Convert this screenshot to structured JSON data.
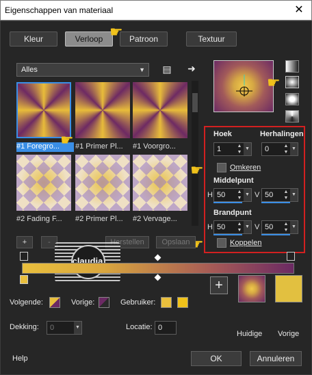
{
  "window": {
    "title": "Eigenschappen van materiaal",
    "close": "✕"
  },
  "tabs": [
    {
      "label": "Kleur",
      "active": false
    },
    {
      "label": "Verloop",
      "active": true
    },
    {
      "label": "Patroon",
      "active": false
    },
    {
      "label": "Textuur",
      "active": false
    }
  ],
  "gallery": {
    "filter": "Alles",
    "items": [
      {
        "label": "#1 Foregro...",
        "kind": "sunburst",
        "selected": true
      },
      {
        "label": "#1 Primer Pl...",
        "kind": "sunburst",
        "selected": false
      },
      {
        "label": "#1 Voorgro...",
        "kind": "sunburst",
        "selected": false
      },
      {
        "label": "#2 Fading F...",
        "kind": "check",
        "selected": false
      },
      {
        "label": "#2 Primer Pl...",
        "kind": "check",
        "selected": false
      },
      {
        "label": "#2 Vervage...",
        "kind": "check",
        "selected": false
      }
    ]
  },
  "settings": {
    "angle_label": "Hoek",
    "angle_value": "1",
    "repeats_label": "Herhalingen",
    "repeats_value": "0",
    "invert_label": "Omkeren",
    "center_label": "Middelpunt",
    "center_h_label": "H",
    "center_h_value": "50",
    "center_v_label": "V",
    "center_v_value": "50",
    "focal_label": "Brandpunt",
    "focal_h_label": "H",
    "focal_h_value": "50",
    "focal_v_label": "V",
    "focal_v_value": "50",
    "link_label": "Koppelen"
  },
  "editor": {
    "add": "+",
    "remove": "-",
    "restore": "Herstellen",
    "save": "Opslaan"
  },
  "bottom": {
    "next_label": "Volgende:",
    "prev_label": "Vorige:",
    "user_label": "Gebruiker:",
    "opacity_label": "Dekking:",
    "opacity_value": "0",
    "location_label": "Locatie:",
    "location_value": "0",
    "current_label": "Huidige",
    "previous_label": "Vorige",
    "help": "Help",
    "ok": "OK",
    "cancel": "Annuleren"
  },
  "watermark": {
    "text": "claudia"
  },
  "colors": {
    "gold": "#e9bf3d",
    "plum": "#6b2a63",
    "selection": "#3a8ee6",
    "highlight_frame": "#d32020"
  }
}
